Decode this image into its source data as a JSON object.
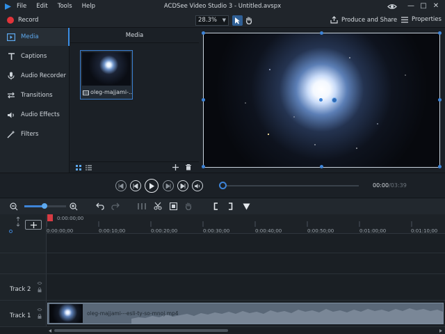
{
  "app": {
    "title": "ACDSee Video Studio 3 - Untitled.avspx",
    "menu": [
      "File",
      "Edit",
      "Tools",
      "Help"
    ],
    "window_controls": [
      "—",
      "□",
      "✕"
    ]
  },
  "toolbar": {
    "record_label": "Record",
    "zoom_value": "28.3%",
    "produce_label": "Produce and Share",
    "properties_label": "Properties"
  },
  "sidebar": {
    "items": [
      {
        "label": "Media",
        "icon": "media-icon"
      },
      {
        "label": "Captions",
        "icon": "captions-icon"
      },
      {
        "label": "Audio Recorder",
        "icon": "microphone-icon"
      },
      {
        "label": "Transitions",
        "icon": "transitions-icon"
      },
      {
        "label": "Audio Effects",
        "icon": "speaker-icon"
      },
      {
        "label": "Filters",
        "icon": "magic-wand-icon"
      }
    ],
    "active": "Media"
  },
  "media_panel": {
    "header": "Media",
    "items": [
      {
        "name": "oleg-majjami-..."
      }
    ]
  },
  "transport": {
    "current_time": "00:00",
    "total_time": "03:39",
    "position": 0.0
  },
  "timeline": {
    "playhead_time": "0:00:00;00",
    "ruler_ticks": [
      "0:00:00;00",
      "0:00:10;00",
      "0:00:20;00",
      "0:00:30;00",
      "0:00:40;00",
      "0:00:50;00",
      "0:01:00;00",
      "0:01:10;00"
    ],
    "tracks": [
      {
        "label": "Track 2"
      },
      {
        "label": "Track 1"
      }
    ],
    "clip_name": "oleg-majjami---esli-ty-so-mnoj.mp4"
  },
  "colors": {
    "accent": "#3e84d8",
    "record": "#e2343a",
    "background": "#1b2026"
  }
}
